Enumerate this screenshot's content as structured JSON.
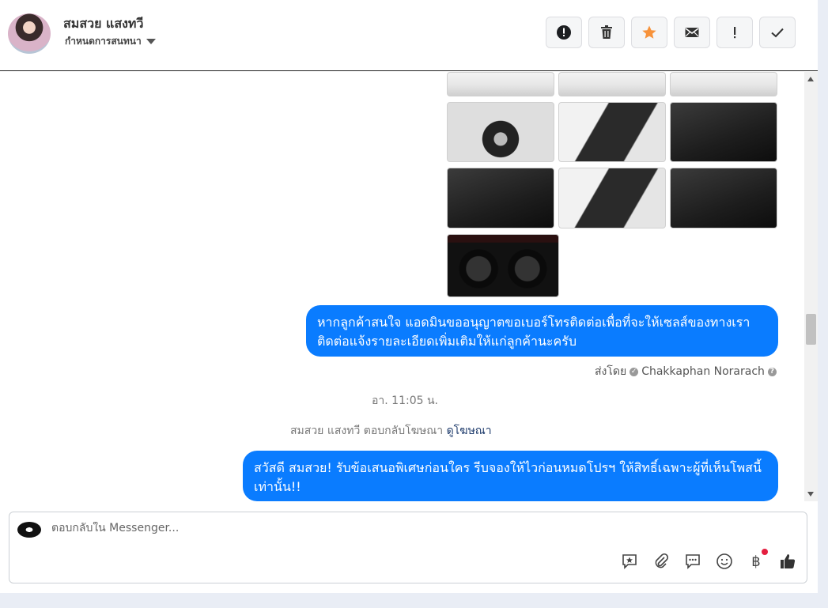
{
  "header": {
    "contact_name": "สมสวย แสงทวี",
    "assign_label": "กำหนดการสนทนา"
  },
  "actions": [
    {
      "name": "report-icon",
      "glyph": "!"
    },
    {
      "name": "trash-icon"
    },
    {
      "name": "star-icon",
      "color": "#f7923a"
    },
    {
      "name": "mail-icon"
    },
    {
      "name": "important-icon",
      "glyph": "!"
    },
    {
      "name": "check-icon"
    }
  ],
  "messages": {
    "bubble1": "หากลูกค้าสนใจ แอดมินขออนุญาตขอเบอร์โทรติดต่อเพื่อที่จะให้เซลส์ของทางเราติดต่อแจ้งรายละเอียดเพิ่มเติมให้แก่ลูกค้านะครับ",
    "sent_by_label": "ส่งโดย",
    "sent_by_name": "Chakkaphan Norarach",
    "time": "อา. 11:05 น.",
    "reply_note": "สมสวย แสงทวี ตอบกลับโฆษณา",
    "reply_link": "ดูโฆษณา",
    "bubble2": "สวัสดี สมสวย! รับข้อเสนอพิเศษก่อนใคร รีบจองให้ไวก่อนหมดโปรฯ ให้สิทธิ์เฉพาะผู้ที่เห็นโพสนี้เท่านั้น!!"
  },
  "composer": {
    "placeholder": "ตอบกลับใน Messenger..."
  },
  "colors": {
    "bubble": "#0a7cff",
    "star": "#f7923a",
    "notification_dot": "#e41e3f"
  }
}
